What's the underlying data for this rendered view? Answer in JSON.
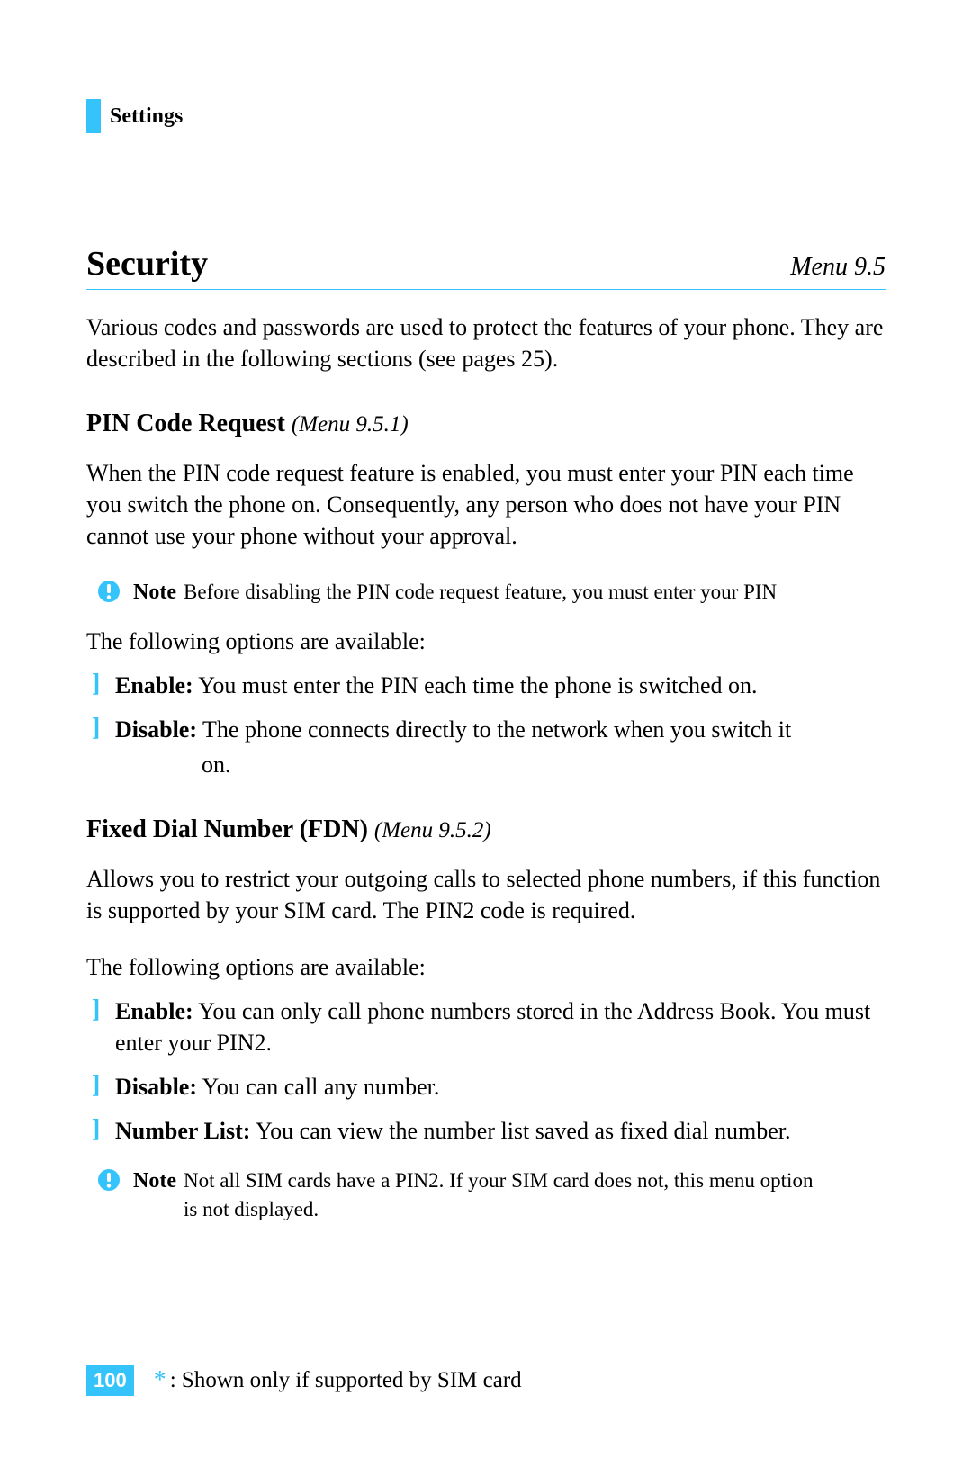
{
  "header": {
    "section": "Settings"
  },
  "title": {
    "text": "Security",
    "menu": "Menu 9.5"
  },
  "intro": "Various codes and passwords are used to protect the features of your phone. They are described in the following sections (see pages 25).",
  "pin": {
    "heading": "PIN Code Request",
    "menu": "(Menu 9.5.1)",
    "body": "When the PIN code request feature is enabled, you must enter your PIN each time you switch the phone on. Consequently, any person who does not have your PIN cannot use your phone without your approval.",
    "note_label": "Note",
    "note_text": "Before disabling the PIN code request feature, you must enter your PIN",
    "options_intro": "The following options are available:",
    "options": [
      {
        "label": "Enable:",
        "text": " You must enter the PIN each time the phone is switched on."
      },
      {
        "label": "Disable:",
        "text": " The phone connects directly to the network when you switch it",
        "cont": "on."
      }
    ]
  },
  "fdn": {
    "heading": "Fixed Dial Number (FDN)",
    "menu": "(Menu 9.5.2)",
    "body": "Allows you to restrict your outgoing calls to selected phone numbers, if this function is supported by your SIM card. The PIN2 code is required.",
    "options_intro": "The following options are available:",
    "options": [
      {
        "label": "Enable:",
        "text": " You can only call phone numbers stored in the Address Book. You must enter your PIN2."
      },
      {
        "label": "Disable:",
        "text": " You can call any number."
      },
      {
        "label": "Number List:",
        "text": " You can view the number list saved as fixed dial number."
      }
    ],
    "note_label": "Note",
    "note_text": "Not all SIM cards have a PIN2. If your SIM card does not, this menu option is not displayed."
  },
  "footer": {
    "page": "100",
    "star": "*",
    "text": ": Shown only if supported by SIM card"
  }
}
